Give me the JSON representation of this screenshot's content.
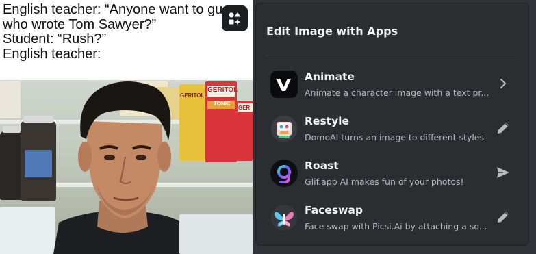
{
  "meme": {
    "caption_lines": [
      "English teacher: “Anyone want to gu",
      "who wrote Tom Sawyer?”",
      "Student: “Rush?”",
      "English teacher:"
    ],
    "product_labels": [
      "GERITOL",
      "GERITOL",
      "TONIC",
      "GER"
    ],
    "apps_button_icon": "apps-icon"
  },
  "panel": {
    "title": "Edit Image with Apps",
    "apps": [
      {
        "name": "Animate",
        "description": "Animate a character image with a text pr...",
        "icon": "animate-logo-icon",
        "action_icon": "chevron-right-icon"
      },
      {
        "name": "Restyle",
        "description": "DomoAI turns an image to different styles",
        "icon": "restyle-logo-icon",
        "action_icon": "pencil-icon"
      },
      {
        "name": "Roast",
        "description": "Glif.app AI makes fun of your photos!",
        "icon": "roast-logo-icon",
        "action_icon": "send-icon"
      },
      {
        "name": "Faceswap",
        "description": "Face swap with Picsi.Ai by attaching a so...",
        "icon": "faceswap-logo-icon",
        "action_icon": "pencil-icon"
      }
    ]
  },
  "colors": {
    "background": "#313338",
    "panel": "#2b2d31",
    "title_text": "#f2f3f5",
    "secondary_text": "#b5bac1",
    "icon_gray": "#b5bac1"
  }
}
